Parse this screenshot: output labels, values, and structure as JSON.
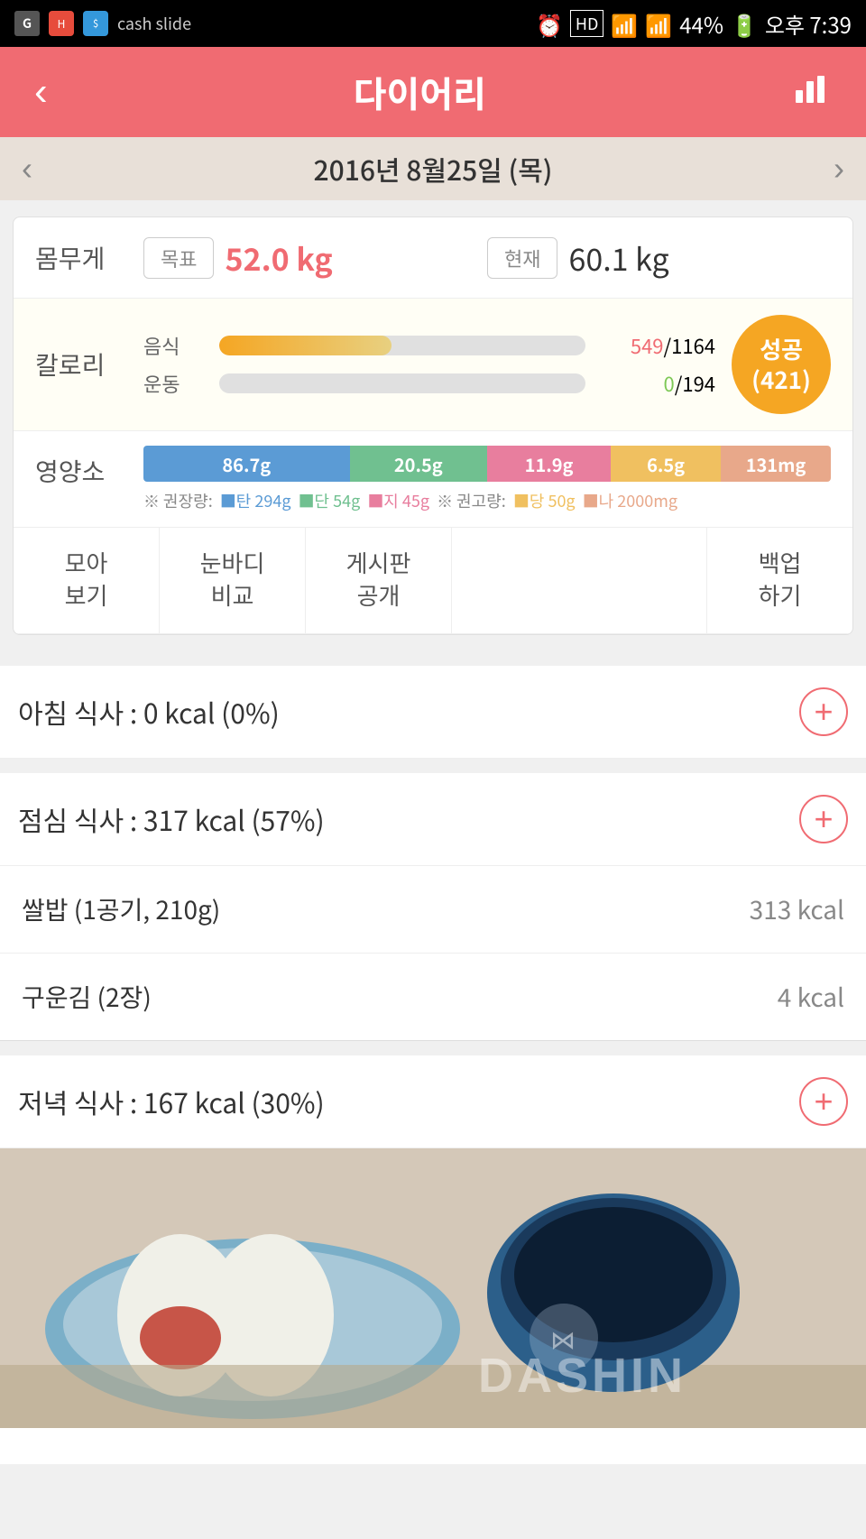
{
  "statusBar": {
    "time": "오후 7:39",
    "battery": "44%",
    "signal": "HD"
  },
  "topNav": {
    "title": "다이어리",
    "backLabel": "‹",
    "chartLabel": "📊"
  },
  "dateBar": {
    "date": "2016년 8월25일 (목)",
    "prevLabel": "‹",
    "nextLabel": "›"
  },
  "weight": {
    "label": "몸무게",
    "goalBadge": "목표",
    "goalValue": "52.0 kg",
    "currentBadge": "현재",
    "currentValue": "60.1 kg"
  },
  "calories": {
    "label": "칼로리",
    "foodLabel": "음식",
    "exerciseLabel": "운동",
    "foodUsed": "549",
    "foodTotal": "1164",
    "exerciseUsed": "0",
    "exerciseTotal": "194",
    "foodBarPct": 47,
    "exerciseBarPct": 0,
    "successLabel": "성공",
    "successValue": "(421)"
  },
  "nutrition": {
    "label": "영양소",
    "segments": [
      {
        "label": "86.7g",
        "widthPct": 30,
        "color": "nutr-blue"
      },
      {
        "label": "20.5g",
        "widthPct": 20,
        "color": "nutr-green"
      },
      {
        "label": "11.9g",
        "widthPct": 18,
        "color": "nutr-pink"
      },
      {
        "label": "6.5g",
        "widthPct": 16,
        "color": "nutr-yellow"
      },
      {
        "label": "131mg",
        "widthPct": 16,
        "color": "nutr-peach"
      }
    ],
    "notePrefix": "※ 권장량:",
    "note1": "■탄 294g",
    "note2": "■단 54g",
    "note3": "■지 45g",
    "notePrefix2": "※ 권고량:",
    "note4": "■당 50g",
    "note5": "■나 2000mg"
  },
  "actions": [
    {
      "id": "gather",
      "label": "모아\n보기"
    },
    {
      "id": "eyebody",
      "label": "눈바디\n비교"
    },
    {
      "id": "board",
      "label": "게시판\n공개"
    },
    {
      "id": "backup",
      "label": "백업\n하기"
    }
  ],
  "meals": [
    {
      "id": "breakfast",
      "title": "아침 식사 : 0 kcal (0%)",
      "items": [],
      "addBtn": "+"
    },
    {
      "id": "lunch",
      "title": "점심 식사 : 317 kcal (57%)",
      "items": [
        {
          "name": "쌀밥 (1공기, 210g)",
          "cal": "313 kcal"
        },
        {
          "name": "구운김 (2장)",
          "cal": "4 kcal"
        }
      ],
      "addBtn": "+"
    },
    {
      "id": "dinner",
      "title": "저녁 식사 : 167 kcal (30%)",
      "hasPhoto": true,
      "items": [],
      "addBtn": "+"
    }
  ],
  "photo": {
    "watermark": "DASHIN"
  }
}
